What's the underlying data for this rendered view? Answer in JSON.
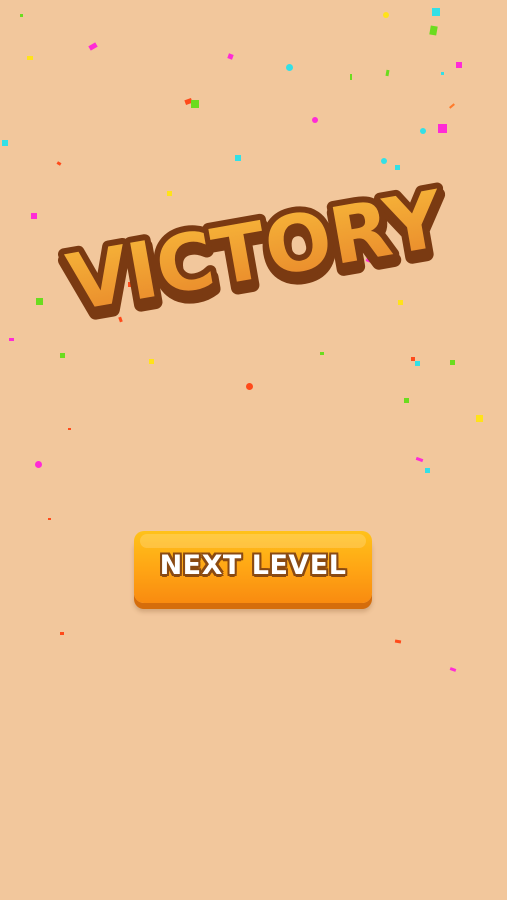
{
  "screen": {
    "background_color": "#f2c79c"
  },
  "victory": {
    "title": "VICTORY",
    "fill_top_color": "#f7b73a",
    "fill_bottom_color": "#e8862a",
    "outline_color": "#7a3a12"
  },
  "next_level_button": {
    "label": "NEXT LEVEL",
    "color_top": "#ffc21a",
    "color_bottom": "#f98b10"
  },
  "confetti": {
    "colors": [
      "#ff2bd6",
      "#33e0e6",
      "#6bdc1f",
      "#ffe21a",
      "#ff4a1a",
      "#ff7a2a"
    ]
  }
}
